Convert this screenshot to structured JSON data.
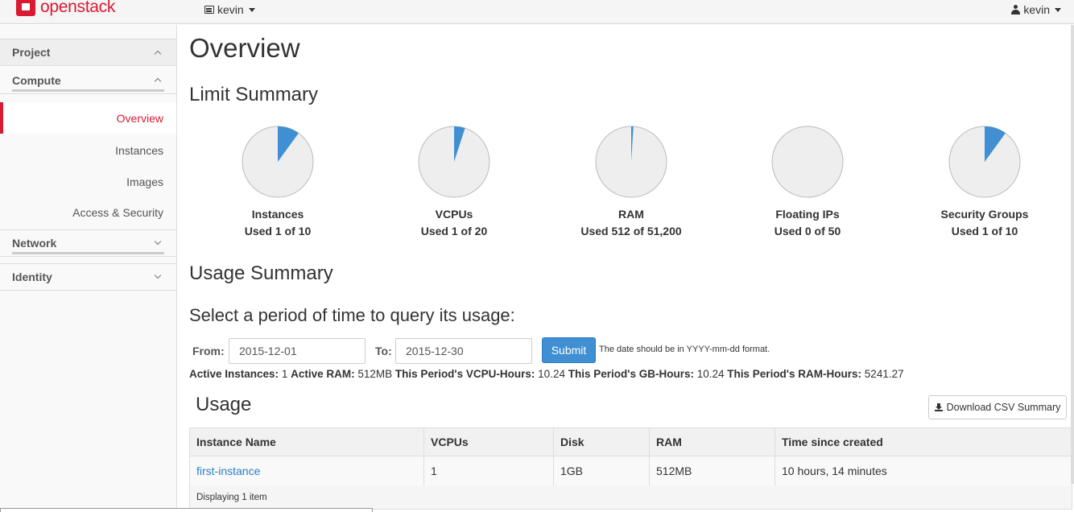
{
  "brand": {
    "name": "openstack"
  },
  "topbar": {
    "project_label": "kevin",
    "user_label": "kevin"
  },
  "sidebar": {
    "sections": [
      {
        "label": "Project"
      },
      {
        "label": "Compute"
      },
      {
        "label": "Network"
      },
      {
        "label": "Identity"
      }
    ],
    "items": [
      {
        "label": "Overview"
      },
      {
        "label": "Instances"
      },
      {
        "label": "Images"
      },
      {
        "label": "Access & Security"
      }
    ]
  },
  "main": {
    "title": "Overview",
    "limit_summary_title": "Limit Summary",
    "limits": [
      {
        "name": "Instances",
        "used_text": "Used 1 of 10",
        "fraction": 0.1
      },
      {
        "name": "VCPUs",
        "used_text": "Used 1 of 20",
        "fraction": 0.05
      },
      {
        "name": "RAM",
        "used_text": "Used 512 of 51,200",
        "fraction": 0.01
      },
      {
        "name": "Floating IPs",
        "used_text": "Used 0 of 50",
        "fraction": 0
      },
      {
        "name": "Security Groups",
        "used_text": "Used 1 of 10",
        "fraction": 0.1
      }
    ],
    "usage_summary_title": "Usage Summary",
    "query_title": "Select a period of time to query its usage:",
    "from_label": "From:",
    "from_value": "2015-12-01",
    "to_label": "To:",
    "to_value": "2015-12-30",
    "submit_label": "Submit",
    "help_text": "The date should be in YYYY-mm-dd format.",
    "stats": {
      "active_instances_label": "Active Instances:",
      "active_instances_value": "1",
      "active_ram_label": "Active RAM:",
      "active_ram_value": "512MB",
      "vcpu_hours_label": "This Period's VCPU-Hours:",
      "vcpu_hours_value": "10.24",
      "gb_hours_label": "This Period's GB-Hours:",
      "gb_hours_value": "10.24",
      "ram_hours_label": "This Period's RAM-Hours:",
      "ram_hours_value": "5241.27"
    },
    "usage_title": "Usage",
    "csv_button": "Download CSV Summary",
    "table": {
      "headers": [
        "Instance Name",
        "VCPUs",
        "Disk",
        "RAM",
        "Time since created"
      ],
      "rows": [
        [
          "first-instance",
          "1",
          "1GB",
          "512MB",
          "10 hours, 14 minutes"
        ]
      ],
      "footer": "Displaying 1 item"
    }
  },
  "colors": {
    "brand_red": "#da1a32",
    "pie_fill": "#3f8fd2",
    "pie_bg": "#eeeeee",
    "link": "#2a7fc9",
    "submit_bg": "#3f8fd2"
  }
}
